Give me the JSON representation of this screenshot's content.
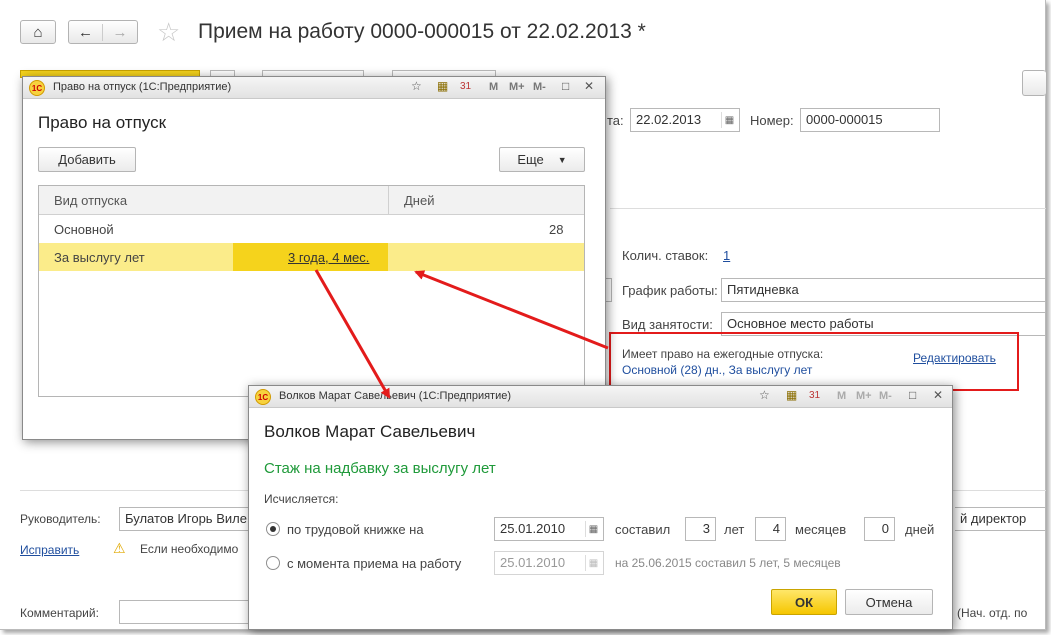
{
  "main": {
    "title": "Прием на работу 0000-000015 от 22.02.2013 *",
    "date_label": "та:",
    "date_value": "22.02.2013",
    "number_label": "Номер:",
    "number_value": "0000-000015",
    "rate_label": "Колич. ставок:",
    "rate_value": "1",
    "schedule_label": "График работы:",
    "schedule_value": "Пятидневка",
    "employment_label": "Вид занятости:",
    "employment_value": "Основное место работы",
    "vacation_text": "Имеет право на ежегодные отпуска:",
    "vacation_value": "Основной (28) дн., За выслугу лет",
    "edit_link": "Редактировать",
    "manager_label": "Руководитель:",
    "manager_value": "Булатов Игорь Виле",
    "position_value": "й директор",
    "fix_link": "Исправить",
    "warning_text": "Если необходимо",
    "comment_label": "Комментарий:",
    "comment_tail": "(Нач. отд. по"
  },
  "leave_window": {
    "window_title": "Право на отпуск  (1С:Предприятие)",
    "heading": "Право на отпуск",
    "add_button": "Добавить",
    "more_button": "Еще",
    "col_type": "Вид отпуска",
    "col_days": "Дней",
    "rows": [
      {
        "type": "Основной",
        "extra": "",
        "days": "28"
      },
      {
        "type": "За выслугу лет",
        "extra": "3 года, 4 мес.",
        "days": ""
      }
    ]
  },
  "seniority_window": {
    "window_title": "Волков Марат Савельевич  (1С:Предприятие)",
    "heading": "Волков Марат Савельевич",
    "subheading": "Стаж на надбавку за выслугу лет",
    "calc_label": "Исчисляется:",
    "option1_label": "по трудовой книжке на",
    "option1_date": "25.01.2010",
    "composed_label": "составил",
    "years_value": "3",
    "years_label": "лет",
    "months_value": "4",
    "months_label": "месяцев",
    "days_value": "0",
    "days_label": "дней",
    "option2_label": "с момента приема на работу",
    "option2_date": "25.01.2010",
    "option2_note": "на 25.06.2015 составил 5 лет, 5 месяцев",
    "ok_button": "ОК",
    "cancel_button": "Отмена"
  },
  "colors": {
    "highlight_row": "#fbec8a",
    "selected_cell": "#f5d31c",
    "annotation_red": "#e31b1b",
    "green_heading": "#1f9a3a",
    "link_blue": "#1f4e9e"
  }
}
